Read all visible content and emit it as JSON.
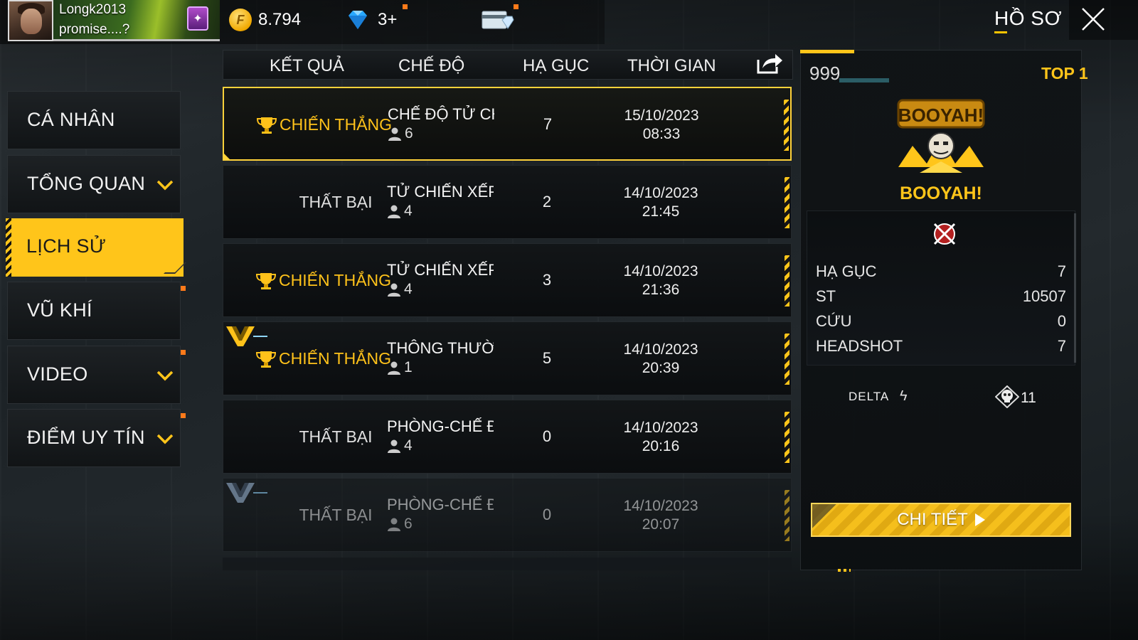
{
  "header": {
    "player_name": "Longk2013",
    "player_signature": "promise....?",
    "coins": "8.794",
    "diamonds": "3+",
    "page_title": "HỒ SƠ"
  },
  "menu": [
    {
      "label": "CÁ NHÂN",
      "has_chevron": false,
      "active": false
    },
    {
      "label": "TỔNG QUAN",
      "has_chevron": true,
      "active": false
    },
    {
      "label": "LỊCH SỬ",
      "has_chevron": false,
      "active": true
    },
    {
      "label": "VŨ KHÍ",
      "has_chevron": false,
      "active": false
    },
    {
      "label": "VIDEO",
      "has_chevron": true,
      "active": false
    },
    {
      "label": "ĐIỂM UY TÍN",
      "has_chevron": true,
      "active": false
    }
  ],
  "table": {
    "headers": [
      "KẾT QUẢ",
      "CHẾ ĐỘ",
      "HẠ GỤC",
      "THỜI GIAN"
    ],
    "rows": [
      {
        "result": "CHIẾN THẮNG",
        "win": true,
        "mode": "CHẾ ĐỘ TỬ CHIẾN",
        "players": "6",
        "kills": "7",
        "date": "15/10/2023",
        "time": "08:33"
      },
      {
        "result": "THẤT BẠI",
        "win": false,
        "mode": "TỬ CHIẾN XẾP HẠ",
        "players": "4",
        "kills": "2",
        "date": "14/10/2023",
        "time": "21:45"
      },
      {
        "result": "CHIẾN THẮNG",
        "win": true,
        "mode": "TỬ CHIẾN XẾP HẠ",
        "players": "4",
        "kills": "3",
        "date": "14/10/2023",
        "time": "21:36"
      },
      {
        "result": "CHIẾN THẮNG",
        "win": true,
        "mode": "THÔNG THƯỜNG-I",
        "players": "1",
        "kills": "5",
        "date": "14/10/2023",
        "time": "20:39"
      },
      {
        "result": "THẤT BẠI",
        "win": false,
        "mode": "PHÒNG-CHẾ ĐỘ T",
        "players": "4",
        "kills": "0",
        "date": "14/10/2023",
        "time": "20:16"
      },
      {
        "result": "THẤT BẠI",
        "win": false,
        "mode": "PHÒNG-CHẾ ĐỘ T",
        "players": "6",
        "kills": "0",
        "date": "14/10/2023",
        "time": "20:07"
      }
    ]
  },
  "detail": {
    "rank": "999",
    "placement": "TOP 1",
    "booyah_logo_text": "BOOYAH!",
    "booyah_label": "BOOYAH!",
    "stats": [
      {
        "label": "HẠ GỤC",
        "value": "7"
      },
      {
        "label": "ST",
        "value": "10507"
      },
      {
        "label": "CỨU",
        "value": "0"
      },
      {
        "label": "HEADSHOT",
        "value": "7"
      }
    ],
    "delta_label": "DELTA",
    "skull_count": "11",
    "details_button": "CHI TIẾT"
  },
  "colors": {
    "accent": "#ffc51a",
    "win": "#ffc21a"
  }
}
